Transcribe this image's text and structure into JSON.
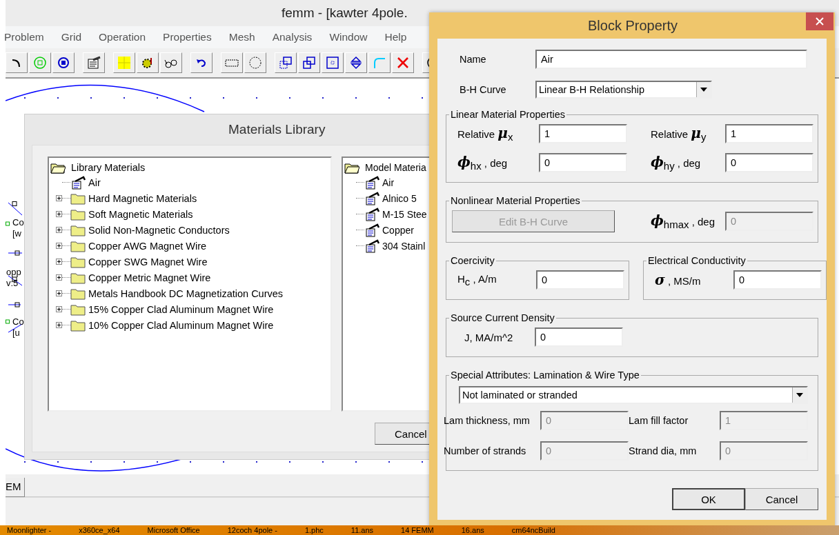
{
  "main_window": {
    "title": "femm - [kawter 4pole.",
    "menu": [
      "Problem",
      "Grid",
      "Operation",
      "Properties",
      "Mesh",
      "Analysis",
      "Window",
      "Help"
    ],
    "canvas_labels": [
      {
        "text": "Co"
      },
      {
        "text": "[w"
      },
      {
        "text": "opp"
      },
      {
        "text": "v:5"
      },
      {
        "text": "Co"
      },
      {
        "text": "[u"
      }
    ],
    "tab": "EM"
  },
  "materials_library": {
    "title": "Materials Library",
    "library_tree": {
      "label": "Library Materials",
      "children": [
        {
          "label": "Air",
          "kind": "material"
        },
        {
          "label": "Hard Magnetic Materials",
          "kind": "folder",
          "expanded": false
        },
        {
          "label": "Soft Magnetic Materials",
          "kind": "folder",
          "expanded": false
        },
        {
          "label": "Solid Non-Magnetic Conductors",
          "kind": "folder",
          "expanded": false
        },
        {
          "label": "Copper AWG Magnet Wire",
          "kind": "folder",
          "expanded": false
        },
        {
          "label": "Copper SWG Magnet Wire",
          "kind": "folder",
          "expanded": false
        },
        {
          "label": "Copper Metric Magnet Wire",
          "kind": "folder",
          "expanded": false
        },
        {
          "label": "Metals Handbook DC Magnetization Curves",
          "kind": "folder",
          "expanded": false
        },
        {
          "label": "15% Copper Clad Aluminum Magnet Wire",
          "kind": "folder",
          "expanded": false
        },
        {
          "label": "10% Copper Clad Aluminum Magnet Wire",
          "kind": "folder",
          "expanded": false
        }
      ]
    },
    "model_tree": {
      "label": "Model Materia",
      "children": [
        {
          "label": "Air",
          "kind": "material"
        },
        {
          "label": "Alnico 5",
          "kind": "material"
        },
        {
          "label": "M-15 Stee",
          "kind": "material"
        },
        {
          "label": "Copper",
          "kind": "material"
        },
        {
          "label": "304 Stainl",
          "kind": "material"
        }
      ]
    },
    "button": "Cancel"
  },
  "block_property": {
    "title": "Block Property",
    "name": {
      "label": "Name",
      "value": "Air"
    },
    "bh_curve": {
      "label": "B-H Curve",
      "value": "Linear B-H Relationship"
    },
    "linear": {
      "title": "Linear Material Properties",
      "fields": [
        {
          "label": "Relative **μ**$_{x}$",
          "value": "1",
          "disabled": false
        },
        {
          "label": "Relative **μ**$_{y}$",
          "value": "1",
          "disabled": false
        },
        {
          "label": "**ϕ**$_{hx}$ , deg",
          "value": "0",
          "disabled": false
        },
        {
          "label": "**ϕ**$_{hy}$ , deg",
          "value": "0",
          "disabled": false
        }
      ]
    },
    "nonlinear": {
      "title": "Nonlinear Material Properties",
      "button": {
        "label": "Edit B-H Curve",
        "disabled": true
      },
      "field": {
        "label": "**ϕ**$_{hmax}$ , deg",
        "value": "0",
        "disabled": true
      }
    },
    "coercivity": {
      "title": "Coercivity",
      "label": "H$_{c}$ , A/m",
      "value": "0",
      "disabled": false
    },
    "conductivity": {
      "title": "Electrical Conductivity",
      "label": "**σ** , MS/m",
      "value": "0",
      "disabled": false
    },
    "source_current": {
      "title": "Source Current Density",
      "label": "J, MA/m^2",
      "value": "0",
      "disabled": false
    },
    "special": {
      "title": "Special Attributes:  Lamination & Wire Type",
      "type": "Not laminated or stranded",
      "fields": [
        {
          "label": "Lam thickness, mm",
          "value": "0",
          "disabled": true
        },
        {
          "label": "Lam fill factor",
          "value": "1",
          "disabled": true
        },
        {
          "label": "Number of strands",
          "value": "0",
          "disabled": true
        },
        {
          "label": "Strand dia, mm",
          "value": "0",
          "disabled": true
        }
      ]
    },
    "buttons": [
      "OK",
      "Cancel"
    ]
  },
  "taskbar": [
    "Moonlighter -",
    "x360ce_x64",
    "Microsoft Office",
    "12coch 4pole -",
    "1.phc",
    "11.ans",
    "14 FEMM",
    "16.ans",
    "cm64ncBuild"
  ]
}
